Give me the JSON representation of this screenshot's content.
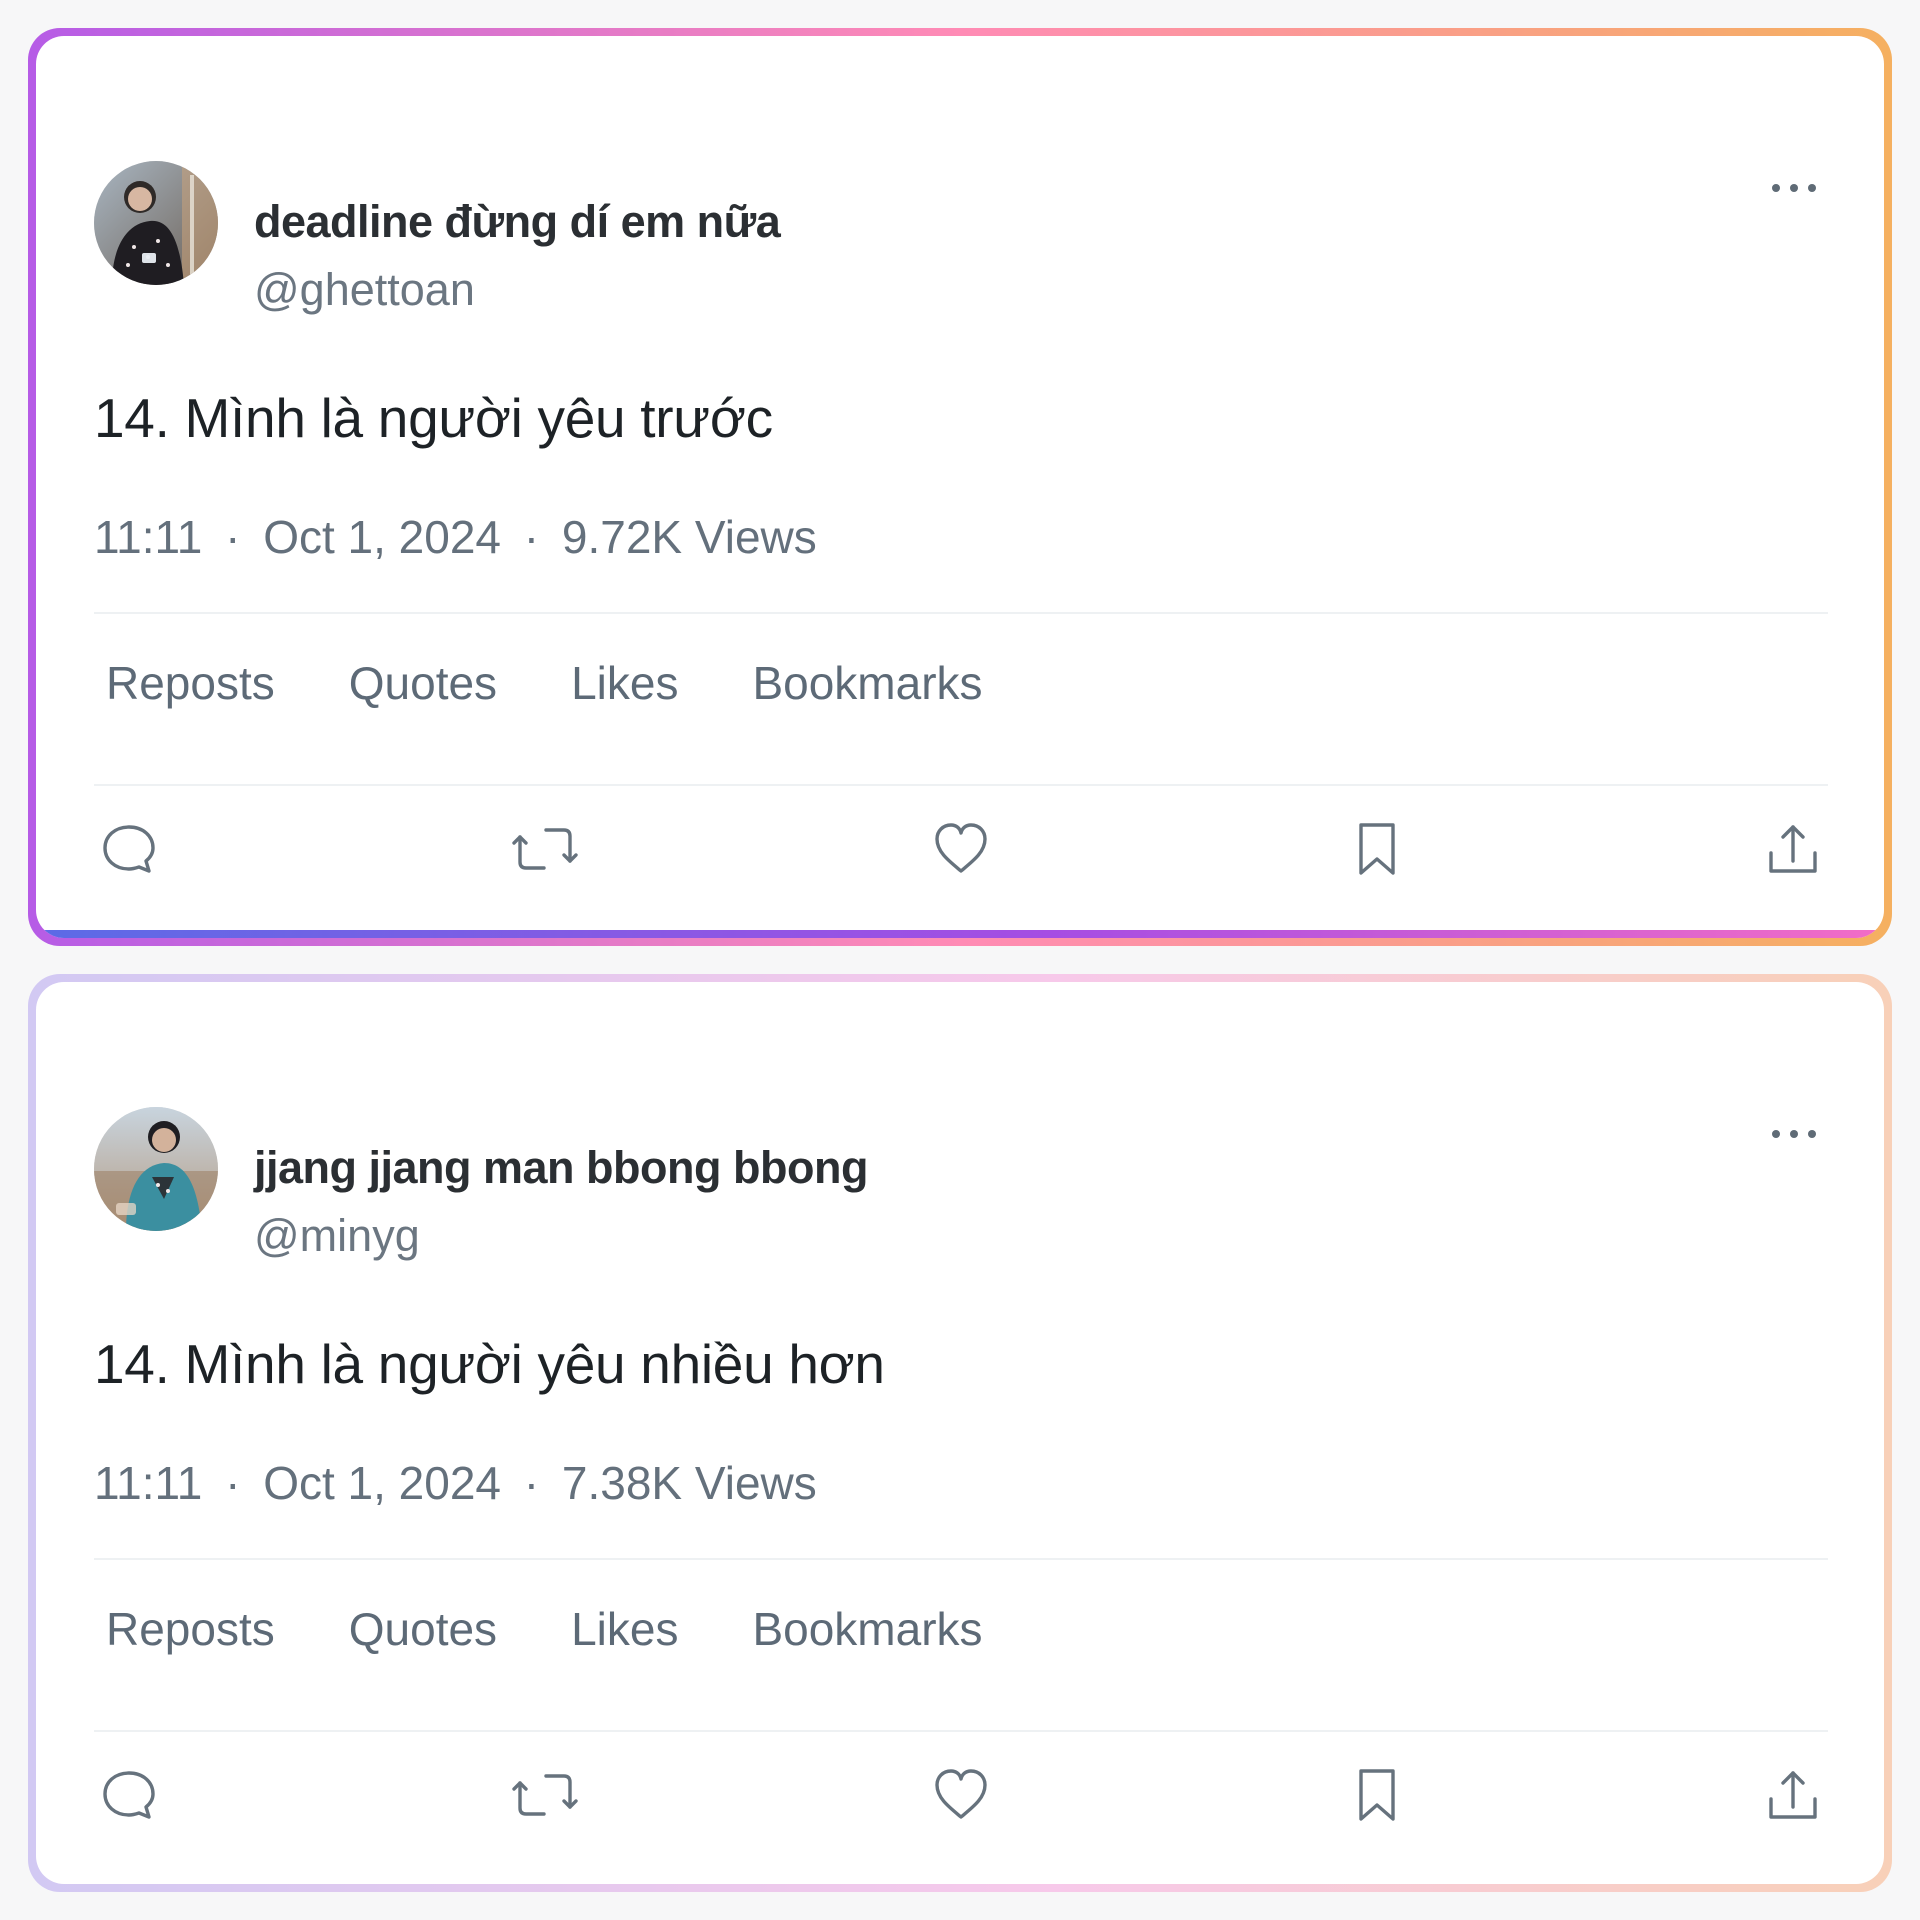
{
  "posts": [
    {
      "author_name": "deadline đừng dí em nữa",
      "handle": "@ghettoan",
      "text": "14. Mình là người yêu trước",
      "time": "11:11",
      "date": "Oct 1, 2024",
      "views": "9.72K Views",
      "tabs": [
        "Reposts",
        "Quotes",
        "Likes",
        "Bookmarks"
      ],
      "actions": [
        "reply-icon",
        "retweet-icon",
        "heart-icon",
        "bookmark-icon",
        "share-icon"
      ]
    },
    {
      "author_name": "jjang jjang man bbong bbong",
      "handle": "@minyg",
      "text": "14. Mình là người yêu nhiều hơn",
      "time": "11:11",
      "date": "Oct 1, 2024",
      "views": "7.38K Views",
      "tabs": [
        "Reposts",
        "Quotes",
        "Likes",
        "Bookmarks"
      ],
      "actions": [
        "reply-icon",
        "retweet-icon",
        "heart-icon",
        "bookmark-icon",
        "share-icon"
      ]
    }
  ],
  "theme": {
    "text_primary": "#1d2226",
    "text_secondary": "#64707c",
    "icon_color": "#66727d",
    "card_1_border_top": [
      "#b65ce6",
      "#ff8bb5",
      "#f5b060"
    ],
    "card_1_border_bottom": [
      "#5b6be6",
      "#a64de3",
      "#f26dc6"
    ],
    "card_2_border": [
      "#d2c9f3",
      "#f7c9ea",
      "#f8d0b8"
    ]
  }
}
